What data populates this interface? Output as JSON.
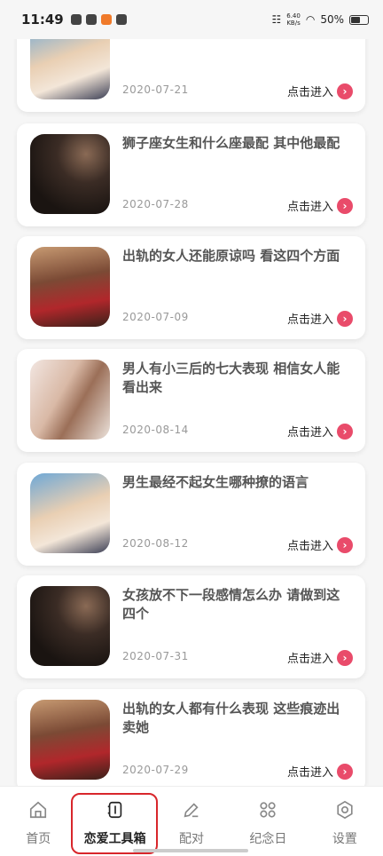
{
  "status_bar": {
    "time": "11:49",
    "speed_top": "6.40",
    "speed_bottom": "KB/s",
    "battery": "50%"
  },
  "articles": [
    {
      "title": "",
      "date": "2020-07-21",
      "enter_label": "点击进入"
    },
    {
      "title": "狮子座女生和什么座最配  其中他最配",
      "date": "2020-07-28",
      "enter_label": "点击进入"
    },
    {
      "title": "出轨的女人还能原谅吗  看这四个方面",
      "date": "2020-07-09",
      "enter_label": "点击进入"
    },
    {
      "title": "男人有小三后的七大表现  相信女人能看出来",
      "date": "2020-08-14",
      "enter_label": "点击进入"
    },
    {
      "title": "男生最经不起女生哪种撩的语言",
      "date": "2020-08-12",
      "enter_label": "点击进入"
    },
    {
      "title": "女孩放不下一段感情怎么办  请做到这四个",
      "date": "2020-07-31",
      "enter_label": "点击进入"
    },
    {
      "title": "出轨的女人都有什么表现  这些痕迹出卖她",
      "date": "2020-07-29",
      "enter_label": "点击进入"
    }
  ],
  "bottom_nav": [
    {
      "label": "首页",
      "icon": "home-icon"
    },
    {
      "label": "恋爱工具箱",
      "icon": "toolbox-icon"
    },
    {
      "label": "配对",
      "icon": "pencil-icon"
    },
    {
      "label": "纪念日",
      "icon": "grid-icon"
    },
    {
      "label": "设置",
      "icon": "settings-icon"
    }
  ],
  "colors": {
    "accent": "#e94b6a",
    "highlight_border": "#d8262b"
  }
}
